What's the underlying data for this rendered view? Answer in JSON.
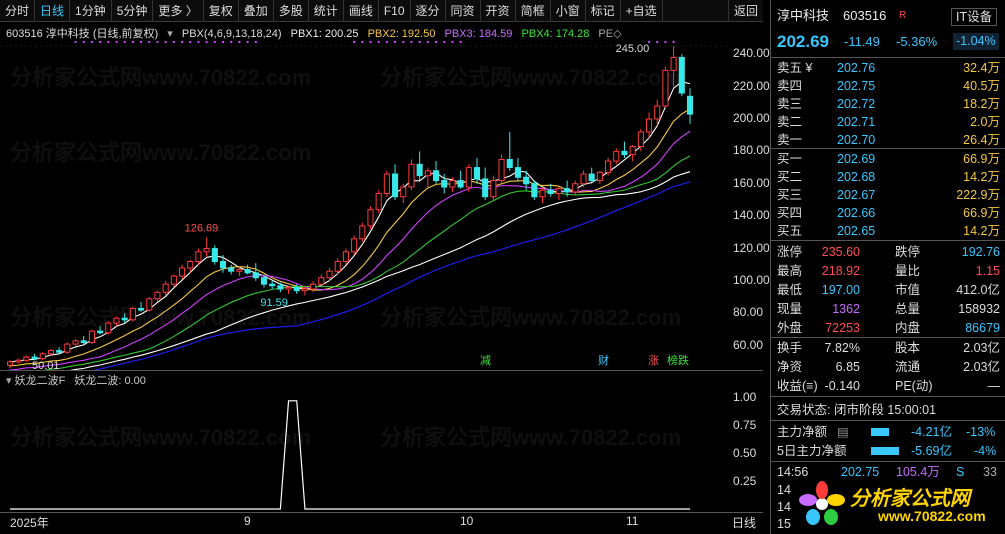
{
  "toolbar": {
    "items": [
      "分时",
      "日线",
      "1分钟",
      "5分钟",
      "更多 〉",
      "复权",
      "叠加",
      "多股",
      "统计",
      "画线",
      "F10",
      "逐分",
      "同资",
      "开资",
      "简框",
      "小窗",
      "标记",
      "+自选",
      "返回"
    ],
    "active": "日线"
  },
  "chart_header": {
    "code_name": "603516 淳中科技 (日线,前复权)",
    "indicator": "PBX(4,6,9,13,18,24)",
    "pbx1": "PBX1: 200.25",
    "pbx2": "PBX2: 192.50",
    "pbx3": "PBX3: 184.59",
    "pbx4": "PBX4: 174.28",
    "pe": "PE◇"
  },
  "price_annotations": {
    "high": "245.00",
    "peak": "126.69",
    "low": "91.59",
    "start": "50.01"
  },
  "y_axis": [
    "240.00",
    "220.00",
    "200.00",
    "180.00",
    "160.00",
    "140.00",
    "120.00",
    "100.00",
    "80.00",
    "60.00"
  ],
  "sub_chart": {
    "title": "妖龙二波F",
    "value": "妖龙二波: 0.00",
    "y_axis": [
      "1.00",
      "0.75",
      "0.50",
      "0.25"
    ]
  },
  "x_axis": [
    "2025年",
    "9",
    "10",
    "11",
    "日线"
  ],
  "event_marks": [
    "减",
    "财",
    "涨",
    "榜跌"
  ],
  "quote": {
    "name": "淳中科技",
    "code": "603516",
    "tag": "R",
    "sector_label": "IT设备",
    "price": "202.69",
    "change": "-11.49",
    "pct": "-5.36%",
    "sector_pct": "-1.04%",
    "sell": [
      {
        "label": "卖五 ¥",
        "price": "202.76",
        "vol": "32.4万"
      },
      {
        "label": "卖四",
        "price": "202.75",
        "vol": "40.5万"
      },
      {
        "label": "卖三",
        "price": "202.72",
        "vol": "18.2万"
      },
      {
        "label": "卖二",
        "price": "202.71",
        "vol": "2.0万"
      },
      {
        "label": "卖一",
        "price": "202.70",
        "vol": "26.4万"
      }
    ],
    "buy": [
      {
        "label": "买一",
        "price": "202.69",
        "vol": "66.9万"
      },
      {
        "label": "买二",
        "price": "202.68",
        "vol": "14.2万"
      },
      {
        "label": "买三",
        "price": "202.67",
        "vol": "222.9万"
      },
      {
        "label": "买四",
        "price": "202.66",
        "vol": "66.9万"
      },
      {
        "label": "买五",
        "price": "202.65",
        "vol": "14.2万"
      }
    ],
    "stats": [
      {
        "l1": "涨停",
        "v1": "235.60",
        "l2": "跌停",
        "v2": "192.76"
      },
      {
        "l1": "最高",
        "v1": "218.92",
        "l2": "量比",
        "v2": "1.15"
      },
      {
        "l1": "最低",
        "v1": "197.00",
        "l2": "市值",
        "v2": "412.0亿"
      },
      {
        "l1": "现量",
        "v1": "1362",
        "l2": "总量",
        "v2": "158932"
      },
      {
        "l1": "外盘",
        "v1": "72253",
        "l2": "内盘",
        "v2": "86679"
      }
    ],
    "stats2": [
      {
        "l1": "换手",
        "v1": "7.82%",
        "l2": "股本",
        "v2": "2.03亿"
      },
      {
        "l1": "净资",
        "v1": "6.85",
        "l2": "流通",
        "v2": "2.03亿"
      },
      {
        "l1": "收益(≡)",
        "v1": "-0.140",
        "l2": "PE(动)",
        "v2": "—"
      }
    ],
    "trade_status": "交易状态: 闭市阶段 15:00:01",
    "main_flow": {
      "label": "主力净额",
      "value": "-4.21亿",
      "pct": "-13%"
    },
    "flow5": {
      "label": "5日主力净额",
      "value": "-5.69亿",
      "pct": "-4%"
    },
    "tick": {
      "time": "14:56",
      "price": "202.75",
      "vol": "105.4万",
      "side": "S",
      "n": "33"
    },
    "tick_times": [
      "14",
      "14",
      "15"
    ]
  },
  "watermark": "分析家公式网www.70822.com",
  "logo": {
    "text": "分析家公式网",
    "url": "www.70822.com"
  },
  "chart_data": {
    "type": "candlestick",
    "ylim": [
      45,
      250
    ],
    "candles": [
      [
        48,
        51,
        46,
        50
      ],
      [
        50,
        52,
        49,
        51
      ],
      [
        51,
        54,
        50,
        53
      ],
      [
        53,
        55,
        51,
        52
      ],
      [
        52,
        56,
        51,
        55
      ],
      [
        55,
        58,
        54,
        57
      ],
      [
        57,
        59,
        55,
        56
      ],
      [
        56,
        62,
        55,
        61
      ],
      [
        61,
        64,
        60,
        63
      ],
      [
        63,
        66,
        61,
        62
      ],
      [
        62,
        70,
        61,
        69
      ],
      [
        69,
        72,
        67,
        68
      ],
      [
        68,
        75,
        67,
        74
      ],
      [
        74,
        78,
        72,
        77
      ],
      [
        77,
        80,
        74,
        76
      ],
      [
        76,
        84,
        75,
        83
      ],
      [
        83,
        87,
        81,
        82
      ],
      [
        82,
        90,
        81,
        89
      ],
      [
        89,
        94,
        87,
        93
      ],
      [
        93,
        100,
        91,
        98
      ],
      [
        98,
        104,
        96,
        103
      ],
      [
        103,
        110,
        101,
        108
      ],
      [
        108,
        113,
        105,
        112
      ],
      [
        112,
        120,
        110,
        118
      ],
      [
        118,
        127,
        115,
        120
      ],
      [
        120,
        122,
        110,
        112
      ],
      [
        112,
        116,
        105,
        108
      ],
      [
        108,
        110,
        104,
        106
      ],
      [
        106,
        109,
        103,
        107
      ],
      [
        107,
        110,
        104,
        105
      ],
      [
        105,
        111,
        100,
        102
      ],
      [
        102,
        104,
        96,
        98
      ],
      [
        98,
        100,
        95,
        97
      ],
      [
        97,
        99,
        93,
        95
      ],
      [
        95,
        97,
        92,
        96
      ],
      [
        96,
        98,
        92,
        94
      ],
      [
        94,
        97,
        91,
        95
      ],
      [
        95,
        100,
        93,
        98
      ],
      [
        98,
        104,
        96,
        102
      ],
      [
        102,
        108,
        100,
        106
      ],
      [
        106,
        114,
        104,
        112
      ],
      [
        112,
        120,
        110,
        118
      ],
      [
        118,
        128,
        116,
        126
      ],
      [
        126,
        136,
        124,
        134
      ],
      [
        134,
        146,
        132,
        144
      ],
      [
        144,
        156,
        142,
        154
      ],
      [
        154,
        168,
        152,
        166
      ],
      [
        166,
        172,
        150,
        152
      ],
      [
        152,
        160,
        148,
        158
      ],
      [
        158,
        175,
        156,
        172
      ],
      [
        172,
        180,
        162,
        165
      ],
      [
        165,
        170,
        158,
        168
      ],
      [
        168,
        174,
        160,
        162
      ],
      [
        162,
        166,
        154,
        158
      ],
      [
        158,
        164,
        155,
        162
      ],
      [
        162,
        168,
        157,
        158
      ],
      [
        158,
        172,
        155,
        170
      ],
      [
        170,
        176,
        160,
        163
      ],
      [
        163,
        170,
        150,
        152
      ],
      [
        152,
        165,
        150,
        162
      ],
      [
        162,
        178,
        160,
        175
      ],
      [
        175,
        192,
        168,
        170
      ],
      [
        170,
        176,
        162,
        164
      ],
      [
        164,
        168,
        156,
        160
      ],
      [
        160,
        162,
        150,
        152
      ],
      [
        152,
        158,
        148,
        156
      ],
      [
        156,
        160,
        152,
        154
      ],
      [
        154,
        158,
        150,
        157
      ],
      [
        157,
        162,
        152,
        155
      ],
      [
        155,
        162,
        153,
        160
      ],
      [
        160,
        168,
        158,
        166
      ],
      [
        166,
        170,
        160,
        162
      ],
      [
        162,
        168,
        160,
        167
      ],
      [
        167,
        176,
        165,
        174
      ],
      [
        174,
        182,
        172,
        180
      ],
      [
        180,
        186,
        176,
        178
      ],
      [
        178,
        184,
        174,
        183
      ],
      [
        183,
        194,
        180,
        192
      ],
      [
        192,
        204,
        188,
        200
      ],
      [
        200,
        212,
        196,
        208
      ],
      [
        208,
        232,
        206,
        230
      ],
      [
        230,
        245,
        220,
        238
      ],
      [
        238,
        240,
        214,
        216
      ],
      [
        214,
        219,
        197,
        203
      ]
    ],
    "series": [
      {
        "name": "PBX1",
        "color": "#ffffff",
        "last": 200.25
      },
      {
        "name": "PBX2",
        "color": "#f5c842",
        "last": 192.5
      },
      {
        "name": "PBX3",
        "color": "#d040ff",
        "last": 184.59
      },
      {
        "name": "PBX4",
        "color": "#32c832",
        "last": 174.28
      }
    ],
    "sub_series": {
      "name": "妖龙二波",
      "values": [
        0,
        0,
        0,
        0,
        0,
        0,
        0,
        0,
        0,
        0,
        0,
        0,
        0,
        0,
        0,
        0,
        0,
        0,
        0,
        0,
        0,
        0,
        0,
        0,
        0,
        0,
        0,
        0,
        0,
        0,
        0,
        0,
        0,
        0,
        1,
        1,
        0,
        0,
        0,
        0,
        0,
        0,
        0,
        0,
        0,
        0,
        0,
        0,
        0,
        0,
        0,
        0,
        0,
        0,
        0,
        0,
        0,
        0,
        0,
        0,
        0,
        0,
        0,
        0,
        0,
        0,
        0,
        0,
        0,
        0,
        0,
        0,
        0,
        0,
        0,
        0,
        0,
        0,
        0,
        0,
        0,
        0,
        0,
        0
      ],
      "ylim": [
        0,
        1.1
      ]
    }
  }
}
